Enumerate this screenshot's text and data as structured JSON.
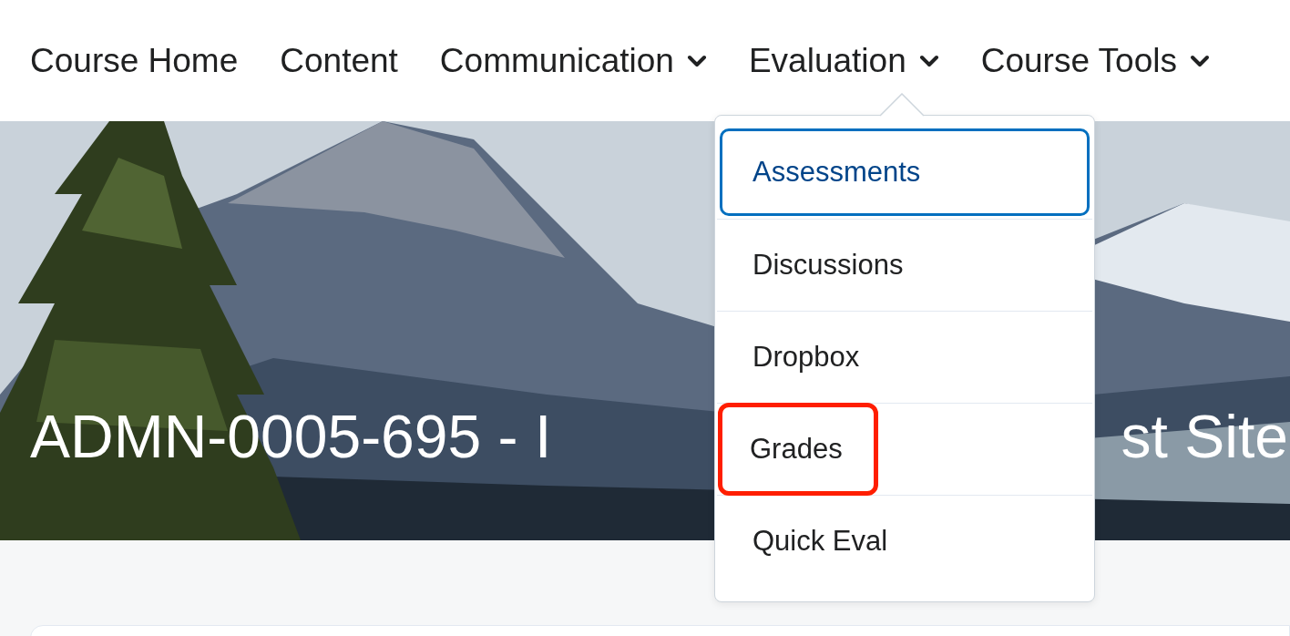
{
  "nav": [
    {
      "label": "Course Home",
      "has_menu": false
    },
    {
      "label": "Content",
      "has_menu": false
    },
    {
      "label": "Communication",
      "has_menu": true
    },
    {
      "label": "Evaluation",
      "has_menu": true
    },
    {
      "label": "Course Tools",
      "has_menu": true
    }
  ],
  "banner": {
    "kind": "picture",
    "title_start": "ADMN-0005-695 - I",
    "title_end": "st Site"
  },
  "menu": {
    "items": [
      {
        "label": "Assessments",
        "selected": true,
        "highlighted": false
      },
      {
        "label": "Discussions",
        "selected": false,
        "highlighted": false
      },
      {
        "label": "Dropbox",
        "selected": false,
        "highlighted": false
      },
      {
        "label": "Grades",
        "selected": false,
        "highlighted": true
      },
      {
        "label": "Quick Eval",
        "selected": false,
        "highlighted": false
      }
    ]
  }
}
